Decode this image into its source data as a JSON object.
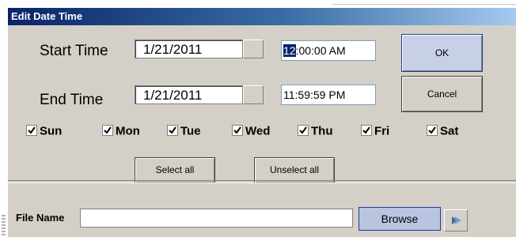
{
  "dialog": {
    "title": "Edit Date Time"
  },
  "start": {
    "label": "Start Time",
    "date": "1/21/2011",
    "time_selected": "12",
    "time_rest": ":00:00 AM"
  },
  "end": {
    "label": "End Time",
    "date": "1/21/2011",
    "time_selected": "11",
    "time_rest": ":59:59 PM"
  },
  "buttons": {
    "ok": "OK",
    "cancel": "Cancel",
    "select_all": "Select all",
    "unselect_all": "Unselect all",
    "browse": "Browse"
  },
  "days": [
    {
      "label": "Sun",
      "checked": true
    },
    {
      "label": "Mon",
      "checked": true
    },
    {
      "label": "Tue",
      "checked": true
    },
    {
      "label": "Wed",
      "checked": true
    },
    {
      "label": "Thu",
      "checked": true
    },
    {
      "label": "Fri",
      "checked": true
    },
    {
      "label": "Sat",
      "checked": true
    }
  ],
  "file": {
    "label": "File Name",
    "value": ""
  },
  "icons": {
    "next": "arrow-right-icon",
    "check": "checkmark-icon"
  },
  "colors": {
    "title_start": "#0a246a",
    "title_end": "#a6caf0",
    "dialog_bg": "#d4d0c8",
    "selection": "#0a246a"
  }
}
